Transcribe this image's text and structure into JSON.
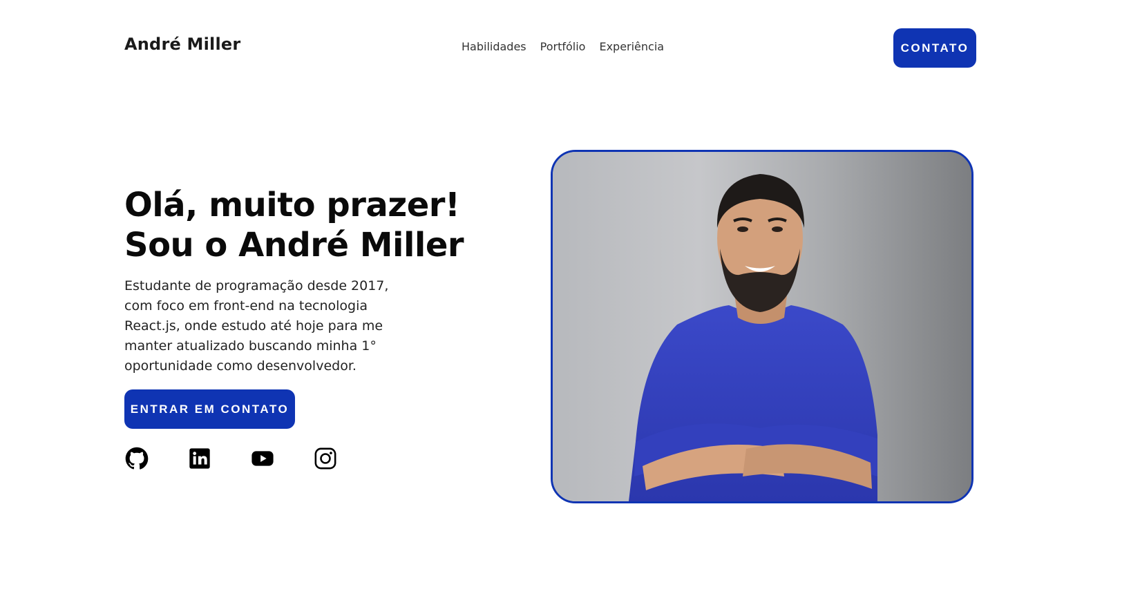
{
  "header": {
    "logo": "André Miller",
    "nav": [
      "Habilidades",
      "Portfólio",
      "Experiência"
    ],
    "contact_button": "CONTATO"
  },
  "hero": {
    "title_line1": "Olá, muito prazer!",
    "title_line2": "Sou o André Miller",
    "description": "Estudante de programação desde 2017, com foco em front-end na tecnologia React.js, onde estudo até hoje para me manter atualizado buscando minha 1° oportunidade como desenvolvedor.",
    "cta_button": "ENTRAR EM CONTATO",
    "socials": [
      "github-icon",
      "linkedin-icon",
      "youtube-icon",
      "instagram-icon"
    ]
  },
  "colors": {
    "accent": "#0f34b3",
    "text": "#111111",
    "background": "#ffffff"
  }
}
